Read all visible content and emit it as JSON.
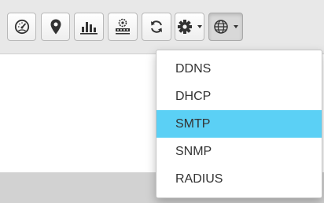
{
  "toolbar": {
    "buttons": [
      {
        "icon": "dashboard-gauge-icon"
      },
      {
        "icon": "location-pin-icon"
      },
      {
        "icon": "bar-chart-icon"
      },
      {
        "icon": "network-hub-icon"
      },
      {
        "icon": "refresh-icon"
      },
      {
        "icon": "gear-icon",
        "has_dropdown": true
      },
      {
        "icon": "globe-icon",
        "has_dropdown": true,
        "active": true
      }
    ]
  },
  "globe_menu": {
    "items": [
      {
        "label": "DDNS",
        "highlighted": false
      },
      {
        "label": "DHCP",
        "highlighted": false
      },
      {
        "label": "SMTP",
        "highlighted": true
      },
      {
        "label": "SNMP",
        "highlighted": false
      },
      {
        "label": "RADIUS",
        "highlighted": false
      }
    ],
    "highlight_color": "#5bd0f5"
  }
}
